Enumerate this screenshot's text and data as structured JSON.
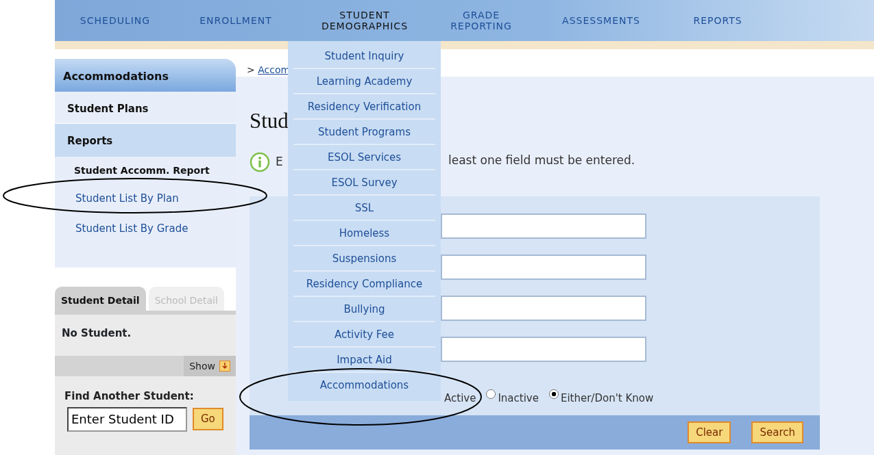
{
  "nav": [
    {
      "label": "SCHEDULING",
      "selected": false
    },
    {
      "label": "ENROLLMENT",
      "selected": false
    },
    {
      "label": "STUDENT DEMOGRAPHICS",
      "selected": true
    },
    {
      "label": "GRADE REPORTING",
      "selected": false
    },
    {
      "label": "ASSESSMENTS",
      "selected": false
    },
    {
      "label": "REPORTS",
      "selected": false
    }
  ],
  "dropdown": {
    "items": [
      "Student Inquiry",
      "Learning Academy",
      "Residency Verification",
      "Student Programs",
      "ESOL Services",
      "ESOL Survey",
      "SSL",
      "Homeless",
      "Suspensions",
      "Residency Compliance",
      "Bullying",
      "Activity Fee",
      "Impact Aid",
      "Accommodations"
    ]
  },
  "sidebar": {
    "title": "Accommodations",
    "items": [
      {
        "kind": "section",
        "label": "Student Plans"
      },
      {
        "kind": "section-active",
        "label": "Reports"
      },
      {
        "kind": "current",
        "label": "Student Accomm. Report"
      },
      {
        "kind": "link",
        "label": "Student List By Plan"
      },
      {
        "kind": "link",
        "label": "Student List By Grade"
      }
    ]
  },
  "detail_tabs": [
    {
      "label": "Student Detail",
      "selected": true
    },
    {
      "label": "School Detail",
      "selected": false
    }
  ],
  "detail_text": "No Student.",
  "show_label": "Show",
  "find": {
    "label": "Find Another Student:",
    "value": "Enter Student ID",
    "button": "Go"
  },
  "breadcrumb": {
    "prefix": ">",
    "link": "Accom"
  },
  "heading": "Stud",
  "info": {
    "before": "E",
    "after": "least one field must be entered."
  },
  "fields": [
    {
      "kind": "text"
    },
    {
      "kind": "text"
    },
    {
      "kind": "text"
    },
    {
      "kind": "text"
    }
  ],
  "status_radios": {
    "leading": "Active",
    "options": [
      {
        "label": "Inactive",
        "selected": false
      },
      {
        "label": "Either/Don't Know",
        "selected": true
      }
    ]
  },
  "buttons": [
    "Clear",
    "Search"
  ]
}
